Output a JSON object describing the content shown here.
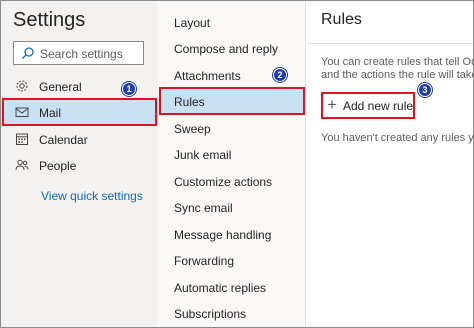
{
  "sidebar": {
    "title": "Settings",
    "search_placeholder": "Search settings",
    "items": [
      {
        "label": "General",
        "icon": "gear-icon"
      },
      {
        "label": "Mail",
        "icon": "mail-icon",
        "selected": true
      },
      {
        "label": "Calendar",
        "icon": "calendar-icon"
      },
      {
        "label": "People",
        "icon": "people-icon"
      }
    ],
    "quick_settings": "View quick settings"
  },
  "mail_menu": {
    "items": [
      {
        "label": "Layout"
      },
      {
        "label": "Compose and reply"
      },
      {
        "label": "Attachments"
      },
      {
        "label": "Rules",
        "selected": true
      },
      {
        "label": "Sweep"
      },
      {
        "label": "Junk email"
      },
      {
        "label": "Customize actions"
      },
      {
        "label": "Sync email"
      },
      {
        "label": "Message handling"
      },
      {
        "label": "Forwarding"
      },
      {
        "label": "Automatic replies"
      },
      {
        "label": "Subscriptions"
      }
    ]
  },
  "rules": {
    "title": "Rules",
    "description_line1": "You can create rules that tell Outl",
    "description_line2": "and the actions the rule will take.",
    "add_label": "Add new rule",
    "empty_text": "You haven't created any rules yet."
  },
  "annotations": {
    "step1": "1",
    "step2": "2",
    "step3": "3",
    "highlight_color": "#e0121f",
    "badge_color": "#1f3fb0"
  },
  "colors": {
    "selected_bg": "#c7e0f4",
    "link": "#0f6cbd"
  }
}
